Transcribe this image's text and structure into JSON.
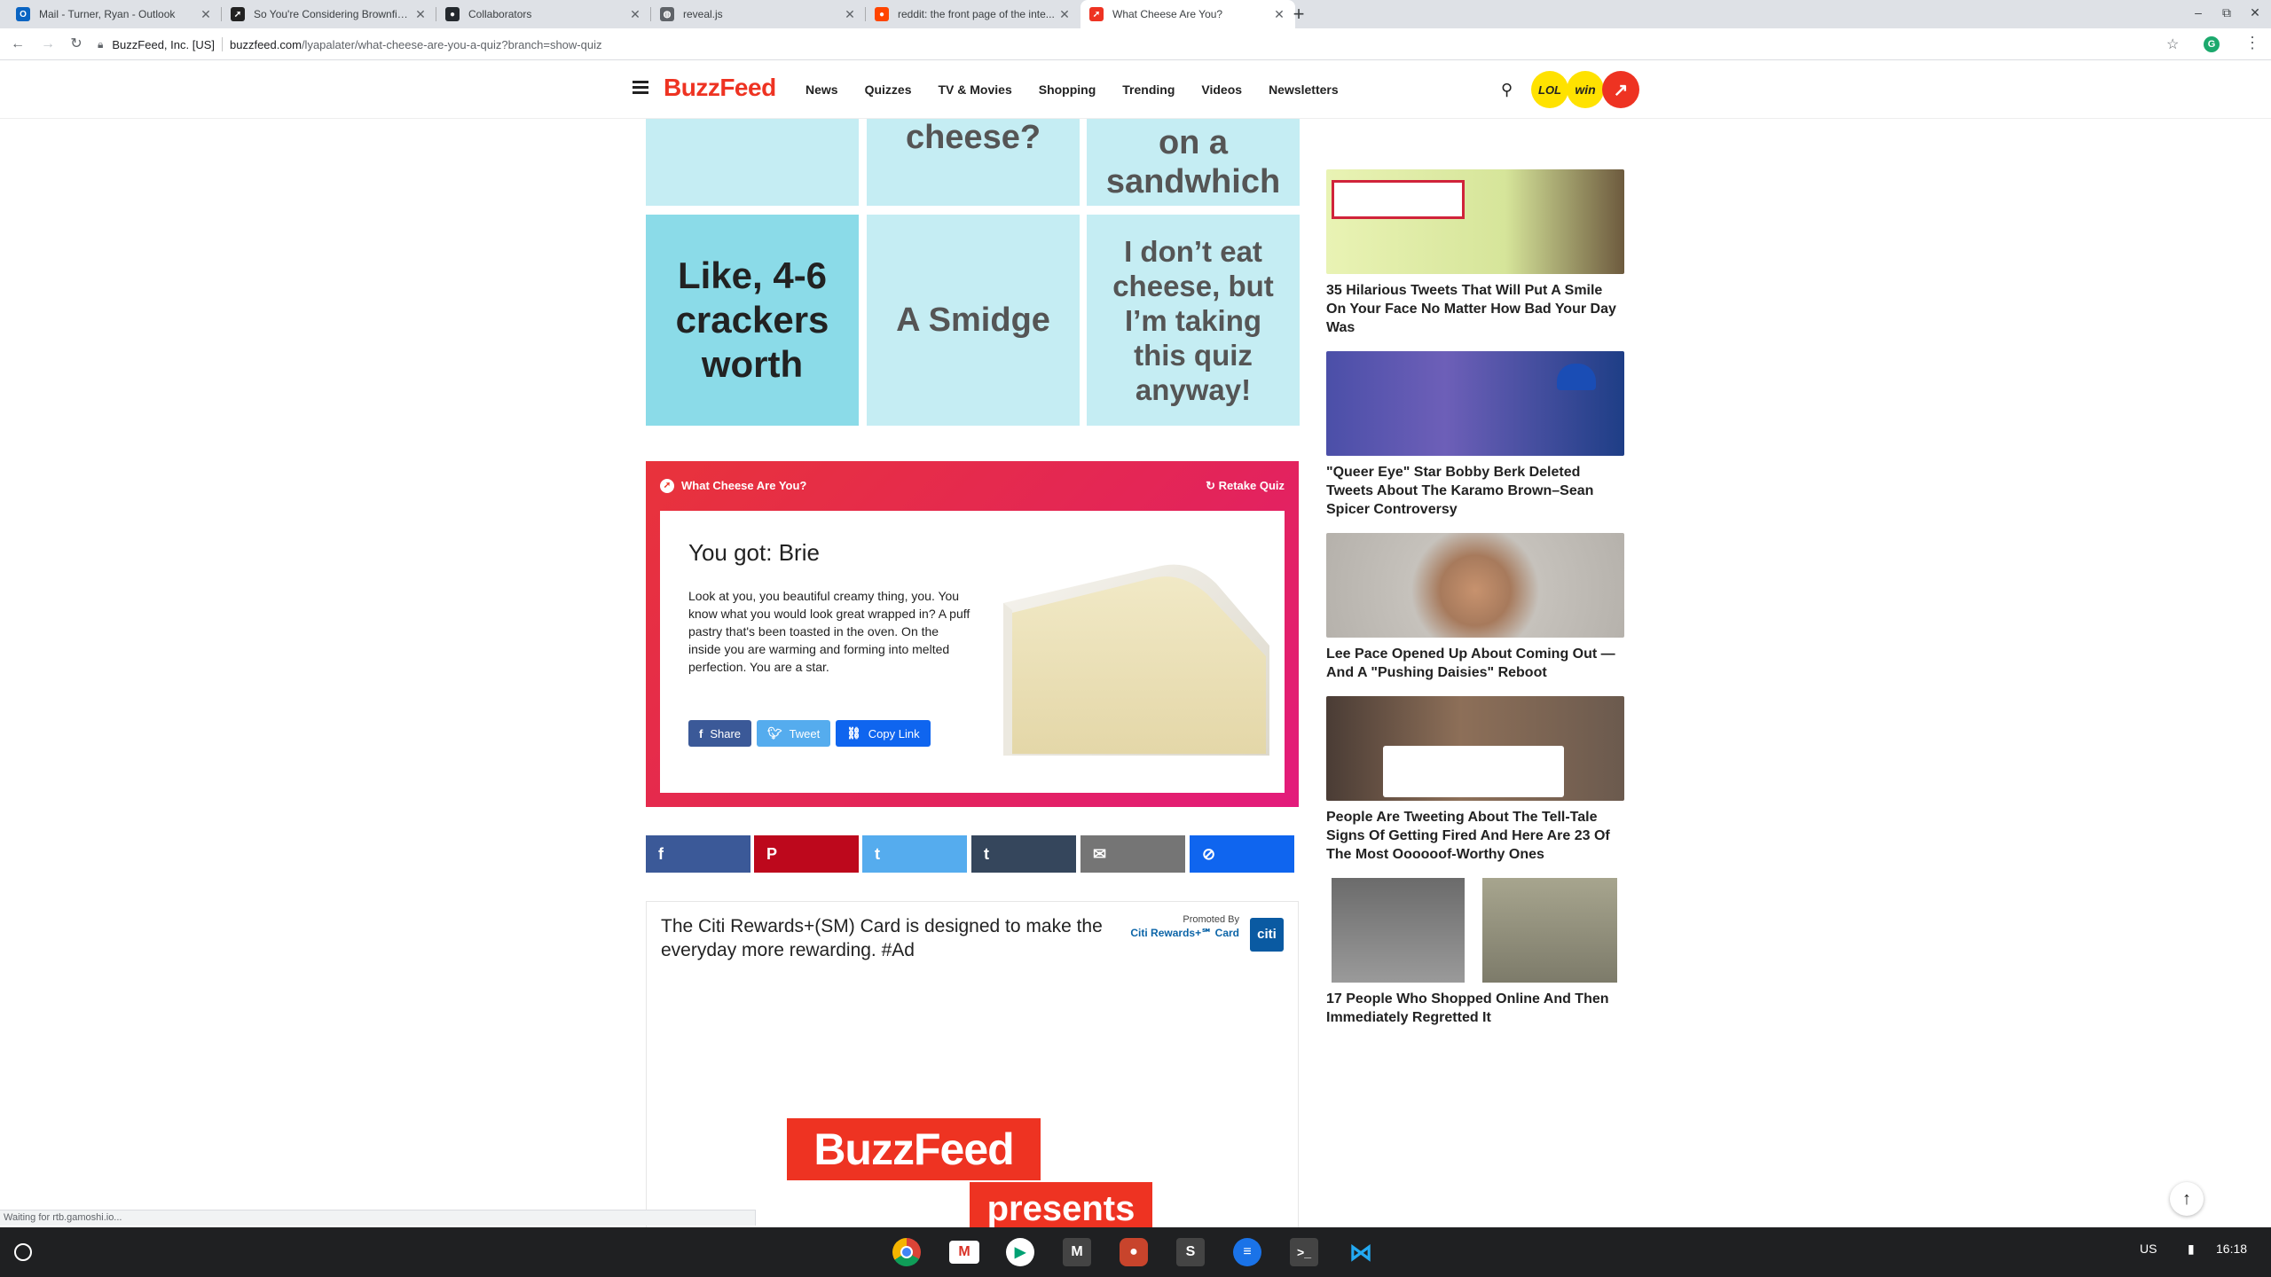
{
  "browser": {
    "tabs": [
      {
        "title": "Mail - Turner, Ryan - Outlook",
        "icon": "outlook-icon",
        "color": "#0a64c2",
        "glyph": "O"
      },
      {
        "title": "So You're Considering Brownfield...",
        "icon": "buzzfeed-tab-icon",
        "color": "#222222",
        "glyph": "➚"
      },
      {
        "title": "Collaborators",
        "icon": "github-icon",
        "color": "#24292e",
        "glyph": "●"
      },
      {
        "title": "reveal.js",
        "icon": "globe-icon",
        "color": "#5f6368",
        "glyph": "◍"
      },
      {
        "title": "reddit: the front page of the inte...",
        "icon": "reddit-icon",
        "color": "#ff4500",
        "glyph": "●"
      },
      {
        "title": "What Cheese Are You?",
        "icon": "buzzfeed-tab-icon",
        "color": "#e32",
        "glyph": "➚"
      }
    ],
    "active_tab": 5,
    "site_identity": "BuzzFeed, Inc. [US]",
    "url_host": "buzzfeed.com",
    "url_path": "/lyapalater/what-cheese-are-you-a-quiz?branch=show-quiz"
  },
  "header": {
    "logo": "BuzzFeed",
    "nav": [
      "News",
      "Quizzes",
      "TV & Movies",
      "Shopping",
      "Trending",
      "Videos",
      "Newsletters"
    ],
    "badges": {
      "lol": "LOL",
      "win": "win",
      "trending": "↗"
    }
  },
  "tiles": [
    {
      "text": "",
      "dark": false
    },
    {
      "text": "cheese?",
      "dark": false
    },
    {
      "text": "on a sandwhich",
      "dark": false
    },
    {
      "text": "Like, 4-6 crackers worth",
      "dark": true
    },
    {
      "text": "A Smidge",
      "dark": false
    },
    {
      "text": "I don’t eat cheese, but I’m taking this quiz anyway!",
      "dark": false
    }
  ],
  "result": {
    "quiz_title": "What Cheese Are You?",
    "retake": "Retake Quiz",
    "headline": "You got: Brie",
    "description": "Look at you, you beautiful creamy thing, you. You know what you would look great wrapped in? A puff pastry that's been toasted in the oven. On the inside you are warming and forming into melted perfection. You are a star.",
    "share": "Share",
    "tweet": "Tweet",
    "copy_link": "Copy Link"
  },
  "share_bar": [
    {
      "name": "facebook",
      "glyph": "f",
      "color": "#3b5998"
    },
    {
      "name": "pinterest",
      "glyph": "P",
      "color": "#bd081c"
    },
    {
      "name": "twitter",
      "glyph": "t",
      "color": "#55acee"
    },
    {
      "name": "tumblr",
      "glyph": "t",
      "color": "#35465c"
    },
    {
      "name": "email",
      "glyph": "✉",
      "color": "#757575"
    },
    {
      "name": "copy-link",
      "glyph": "⊘",
      "color": "#0f65ef"
    }
  ],
  "ad": {
    "text": "The Citi Rewards+(SM) Card is designed to make the everyday more rewarding. #Ad",
    "promoted_by": "Promoted By",
    "brand": "Citi Rewards+℠ Card",
    "brand_logo": "citi",
    "creative_line1": "BuzzFeed",
    "creative_line2": "presents"
  },
  "sidebar": [
    {
      "title": "35 Hilarious Tweets That Will Put A Smile On Your Face No Matter How Bad Your Day Was",
      "colors": [
        "#e7f5a8",
        "#6a5a3d"
      ]
    },
    {
      "title": "\"Queer Eye\" Star Bobby Berk Deleted Tweets About The Karamo Brown–Sean Spicer Controversy",
      "colors": [
        "#3b3d8c",
        "#1c3f8e"
      ]
    },
    {
      "title": "Lee Pace Opened Up About Coming Out — And A \"Pushing Daisies\" Reboot",
      "colors": [
        "#b7b3ad",
        "#8a6d59"
      ]
    },
    {
      "title": "People Are Tweeting About The Tell-Tale Signs Of Getting Fired And Here Are 23 Of The Most Oooooof-Worthy Ones",
      "colors": [
        "#5a4a40",
        "#9c7a62"
      ]
    },
    {
      "title": "17 People Who Shopped Online And Then Immediately Regretted It",
      "colors": [
        "#7a7a7a",
        "#9a9a8a"
      ]
    }
  ],
  "status_text": "Waiting for rtb.gamoshi.io...",
  "tray": {
    "locale": "US",
    "time": "16:18"
  }
}
